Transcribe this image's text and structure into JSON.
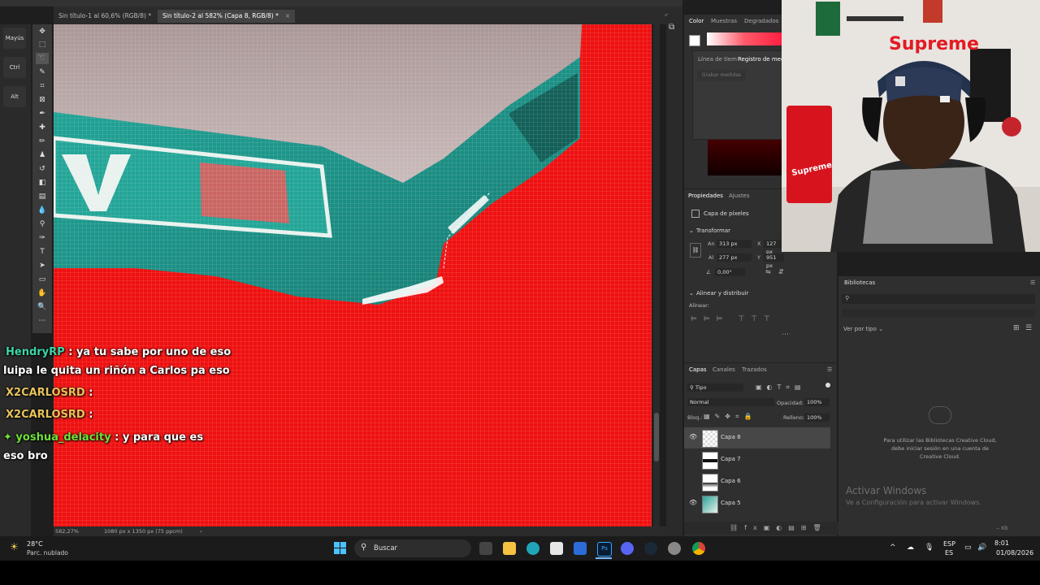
{
  "app": {
    "tabs": [
      {
        "label": "Sin título-1 al 60,6% (RGB/8) *",
        "close": "×"
      },
      {
        "label": "Sin título-2 al 582% (Capa 8, RGB/8) *",
        "close": "×"
      }
    ],
    "status_zoom": "582,27%",
    "status_doc": "1080 px x 1350 px (75 ppcm)"
  },
  "key_buttons": [
    "Mayús",
    "Ctrl",
    "Alt"
  ],
  "chat": [
    {
      "user": "HendryRP",
      "sep": " : ",
      "text": "ya tu sabe por uno de eso",
      "color": "teal"
    },
    {
      "user": "",
      "sep": "",
      "text": "luipa le quita un riñón a Carlos pa eso",
      "color": "none"
    },
    {
      "user": "X2CARLOSRD",
      "sep": " : ",
      "text": "",
      "color": "gold"
    },
    {
      "user": "X2CARLOSRD",
      "sep": " : ",
      "text": "",
      "color": "gold"
    },
    {
      "user": "yoshua_delacity",
      "sep": " : ",
      "text": "y para que es",
      "color": "green"
    },
    {
      "user": "",
      "sep": "",
      "text": "eso bro",
      "color": "none"
    }
  ],
  "color_panel": {
    "tabs": [
      "Color",
      "Muestras",
      "Degradados"
    ],
    "history_tabs": [
      "Línea de tiem",
      "Registro de medi"
    ],
    "history_button": "Grabar medidas"
  },
  "properties": {
    "tabs": [
      "Propiedades",
      "Ajustes"
    ],
    "kind": "Capa de píxeles",
    "transform_title": "Transformar",
    "w_label": "An",
    "w_value": "313 px",
    "x_label": "X",
    "x_value": "127 px",
    "h_label": "Al",
    "h_value": "277 px",
    "y_label": "Y",
    "y_value": "951 px",
    "angle_value": "0,00°",
    "align_title": "Alinear y distribuir",
    "align_label": "Alinear:"
  },
  "layers_panel": {
    "tabs": [
      "Capas",
      "Canales",
      "Trazados"
    ],
    "filter": "Tipo",
    "blend": "Normal",
    "opacity_label": "Opacidad:",
    "opacity_value": "100%",
    "lock_label": "Bloq.:",
    "fill_label": "Relleno:",
    "fill_value": "100%",
    "layers": [
      {
        "name": "Capa 8",
        "selected": true,
        "visible": true
      },
      {
        "name": "Capa 7",
        "selected": false,
        "visible": false
      },
      {
        "name": "Capa 6",
        "selected": false,
        "visible": false
      },
      {
        "name": "Capa 5",
        "selected": false,
        "visible": true
      }
    ]
  },
  "libraries": {
    "title": "Bibliotecas",
    "view": "Ver por tipo",
    "message": "Para utilizar las Bibliotecas Creative Cloud, debe iniciar sesión en una cuenta de Creative Cloud.",
    "size": "-- KB"
  },
  "watermark": {
    "title": "Activar Windows",
    "subtitle": "Ve a Configuración para activar Windows."
  },
  "webcam": {
    "sign": "Supreme",
    "bag": "Supreme"
  },
  "taskbar": {
    "weather_temp": "28°C",
    "weather_desc": "Parc. nublado",
    "search": "Buscar",
    "lang_top": "ESP",
    "lang_bottom": "ES",
    "time": "8:01",
    "date": "01/08/2026"
  }
}
